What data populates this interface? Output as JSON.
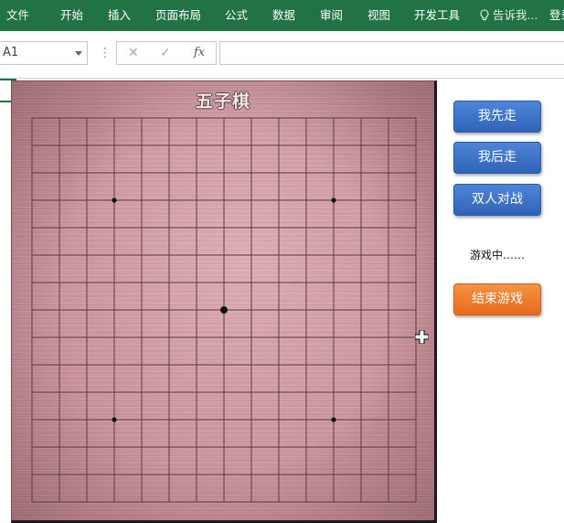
{
  "ribbon": {
    "menu": [
      "文件",
      "开始",
      "插入",
      "页面布局",
      "公式",
      "数据",
      "审阅",
      "视图",
      "开发工具"
    ],
    "tell_me": "告诉我...",
    "login": "登录",
    "bg_color": "#217346"
  },
  "formula_bar": {
    "name_box": "A1",
    "cancel_symbol": "✕",
    "enter_symbol": "✓",
    "fx_label": "fx",
    "formula": ""
  },
  "game": {
    "title": "五子棋",
    "board_lines": 15,
    "star_points": [
      [
        4,
        4
      ],
      [
        4,
        12
      ],
      [
        8,
        8
      ],
      [
        12,
        4
      ],
      [
        12,
        12
      ]
    ],
    "board_color": "#c9939a"
  },
  "controls": {
    "first_move": "我先走",
    "second_move": "我后走",
    "two_player": "双人对战",
    "status": "游戏中……",
    "end_game": "结束游戏",
    "accent_blue": "#3a6fc6",
    "accent_orange": "#ed7a2b"
  }
}
